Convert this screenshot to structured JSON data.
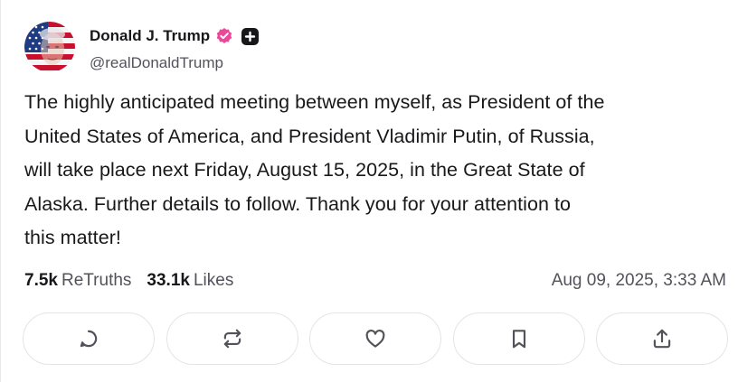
{
  "author": {
    "display_name": "Donald J. Trump",
    "handle": "@realDonaldTrump",
    "verified_color": "#ec4899"
  },
  "post": {
    "text": "The highly anticipated meeting between myself, as President of the\nUnited States of America, and President Vladimir Putin, of Russia,\nwill take place next Friday, August 15, 2025, in the Great State of\nAlaska. Further details to follow. Thank you for your attention to\nthis matter!",
    "retruths_count": "7.5k",
    "retruths_label": "ReTruths",
    "likes_count": "33.1k",
    "likes_label": "Likes",
    "timestamp": "Aug 09, 2025, 3:33 AM"
  },
  "actions": [
    {
      "icon": "reply-icon"
    },
    {
      "icon": "retruth-icon"
    },
    {
      "icon": "like-icon"
    },
    {
      "icon": "bookmark-icon"
    },
    {
      "icon": "share-icon"
    }
  ],
  "colors": {
    "text": "#18181b",
    "muted": "#52525b",
    "border": "#e4e4e7"
  }
}
